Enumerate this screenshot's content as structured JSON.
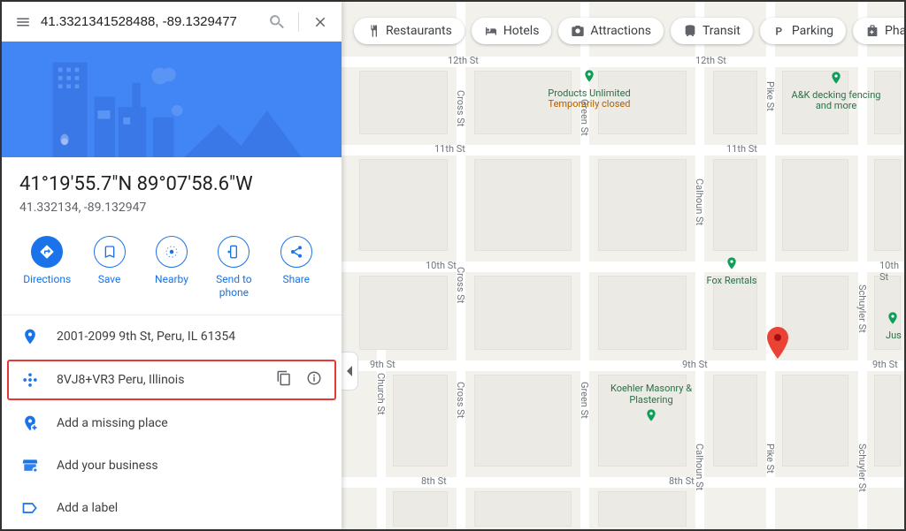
{
  "search": {
    "value": "41.3321341528488, -89.1329477"
  },
  "chips": [
    {
      "label": "Restaurants"
    },
    {
      "label": "Hotels"
    },
    {
      "label": "Attractions"
    },
    {
      "label": "Transit"
    },
    {
      "label": "Parking"
    },
    {
      "label": "Pharmacies"
    }
  ],
  "place": {
    "title": "41°19'55.7\"N 89°07'58.6\"W",
    "subtitle": "41.332134, -89.132947"
  },
  "actions": {
    "directions": "Directions",
    "save": "Save",
    "nearby": "Nearby",
    "send": "Send to phone",
    "share": "Share"
  },
  "info": {
    "address": "2001-2099 9th St, Peru, IL 61354",
    "pluscode": "8VJ8+VR3 Peru, Illinois",
    "addMissing": "Add a missing place",
    "addBusiness": "Add your business",
    "addLabel": "Add a label"
  },
  "map": {
    "streets_h": [
      "12th St",
      "11th St",
      "10th St",
      "9th St",
      "8th St"
    ],
    "streets_v": [
      "Church St",
      "Cross St",
      "Green St",
      "Calhoun St",
      "Pike St",
      "Schuyler St"
    ],
    "pois": [
      {
        "name": "Products Unlimited",
        "sub": "Temporarily closed"
      },
      {
        "name": "A&K decking fencing and more"
      },
      {
        "name": "Fox Rentals"
      },
      {
        "name": "Koehler Masonry & Plastering"
      },
      {
        "name": "Jus"
      }
    ]
  }
}
